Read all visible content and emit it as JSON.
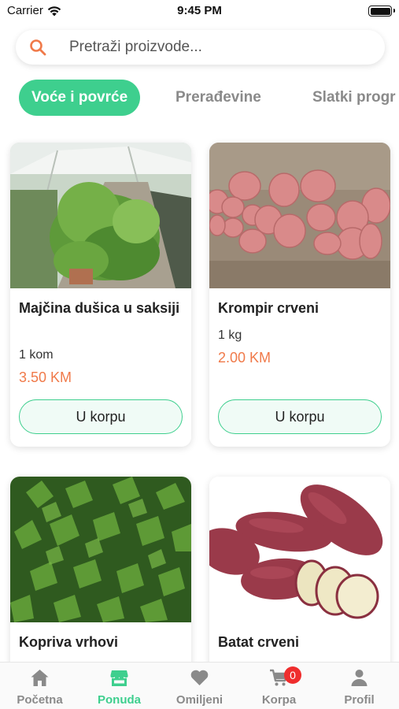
{
  "status_bar": {
    "carrier": "Carrier",
    "time": "9:45 PM"
  },
  "search": {
    "placeholder": "Pretraži proizvode...",
    "icon": "search-icon"
  },
  "categories": [
    {
      "label": "Voće i povrće",
      "active": true
    },
    {
      "label": "Prerađevine",
      "active": false
    },
    {
      "label": "Slatki progr",
      "active": false
    }
  ],
  "products": [
    {
      "name": "Majčina dušica u saksiji",
      "unit": "1 kom",
      "price": "3.50 KM",
      "button": "U korpu",
      "image": "thyme-greenhouse-photo"
    },
    {
      "name": "Krompir crveni",
      "unit": "1 kg",
      "price": "2.00 KM",
      "button": "U korpu",
      "image": "red-potatoes-photo"
    },
    {
      "name": "Kopriva vrhovi",
      "image": "nettle-leaves-photo"
    },
    {
      "name": "Batat crveni",
      "image": "sweet-potato-photo"
    }
  ],
  "bottom_nav": [
    {
      "label": "Početna",
      "icon": "home-icon",
      "active": false
    },
    {
      "label": "Ponuda",
      "icon": "store-icon",
      "active": true
    },
    {
      "label": "Omiljeni",
      "icon": "heart-icon",
      "active": false
    },
    {
      "label": "Korpa",
      "icon": "cart-icon",
      "active": false,
      "badge": "0"
    },
    {
      "label": "Profil",
      "icon": "person-icon",
      "active": false
    }
  ],
  "colors": {
    "accent": "#3ecf8e",
    "price": "#f07a4a",
    "badge": "#ef2d2d",
    "inactive": "#8a8a8a"
  }
}
